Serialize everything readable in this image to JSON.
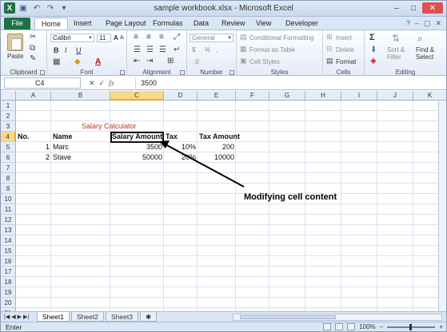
{
  "window": {
    "title": "sample workbook.xlsx - Microsoft Excel",
    "app_icon": "X",
    "controls": {
      "minimize": "–",
      "maximize": "□",
      "close": "✕"
    },
    "qat_icons": [
      "excel-icon",
      "save-icon",
      "undo-icon",
      "redo-icon",
      "customize-icon"
    ]
  },
  "ribbon_tabs": [
    "File",
    "Home",
    "Insert",
    "Page Layout",
    "Formulas",
    "Data",
    "Review",
    "View",
    "Developer"
  ],
  "active_tab": "Home",
  "ribbon": {
    "clipboard": {
      "label": "Clipboard",
      "paste": "Paste"
    },
    "font": {
      "label": "Font",
      "font_name": "Calibri",
      "font_size": "11",
      "bold": "B",
      "italic": "I",
      "underline": "U",
      "grow": "A",
      "shrink": "A",
      "font_color": "A"
    },
    "alignment": {
      "label": "Alignment"
    },
    "number": {
      "label": "Number",
      "format": "General",
      "currency": "$",
      "percent": "%",
      "comma": ",",
      "inc_dec": ".0",
      ".dec": ".00"
    },
    "styles": {
      "label": "Styles",
      "conditional": "Conditional Formatting",
      "format_table": "Format as Table",
      "cell_styles": "Cell Styles"
    },
    "cells": {
      "label": "Cells",
      "insert": "Insert",
      "delete": "Delete",
      "format": "Format"
    },
    "editing": {
      "label": "Editing",
      "sigma": "Σ",
      "sort": "Sort &",
      "filter": "Filter",
      "find": "Find &",
      "select": "Select"
    }
  },
  "formula_bar": {
    "name_box": "C4",
    "cancel": "✕",
    "enter": "✓",
    "fx": "fx",
    "content": "3500"
  },
  "columns": [
    "A",
    "B",
    "C",
    "D",
    "E",
    "F",
    "G",
    "H",
    "I",
    "J",
    "K"
  ],
  "selected_column": "C",
  "rows": [
    "1",
    "2",
    "3",
    "4",
    "5",
    "6",
    "7",
    "8",
    "9",
    "10",
    "11",
    "12",
    "13",
    "14",
    "15",
    "16",
    "17",
    "18",
    "19",
    "20",
    "21"
  ],
  "selected_row": "4",
  "sheet": {
    "title": "Salary Calculator",
    "headers": {
      "no": "No.",
      "name": "Name",
      "salary": "Salary Amount",
      "tax": "Tax",
      "tax_amount": "Tax Amount"
    },
    "data": [
      {
        "no": "1",
        "name": "Marc",
        "salary": "3500",
        "tax": "10%",
        "tax_amount": "200"
      },
      {
        "no": "2",
        "name": "Stave",
        "salary": "50000",
        "tax": "20%",
        "tax_amount": "10000"
      }
    ]
  },
  "annotation": "Modifying cell content",
  "sheet_tabs": [
    "Sheet1",
    "Sheet2",
    "Sheet3"
  ],
  "active_sheet": "Sheet1",
  "status": {
    "mode": "Enter",
    "zoom": "100%"
  }
}
